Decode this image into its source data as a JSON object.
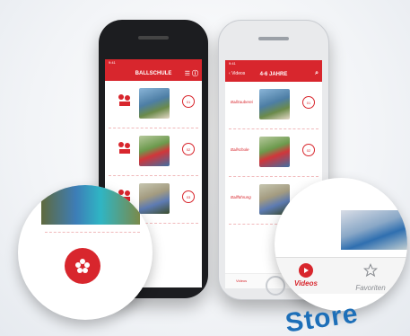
{
  "dark_phone": {
    "status": "9:41",
    "title": "BALLSCHULE",
    "rows": [
      {
        "badge": "01"
      },
      {
        "badge": "02"
      },
      {
        "badge": "03"
      }
    ]
  },
  "light_phone": {
    "status": "9:41",
    "back_label": "Videos",
    "title": "4-6 JAHRE",
    "rows": [
      {
        "label": "Ballzauberei",
        "badge": "01"
      },
      {
        "label": "Ballschule",
        "badge": "02"
      },
      {
        "label": "Ballführung",
        "badge": "03"
      }
    ],
    "tab_videos": "Videos"
  },
  "zoom_right": {
    "tab_videos": "Videos",
    "tab_favoriten": "Favoriten"
  },
  "brand_text": "Store",
  "colors": {
    "accent": "#d8262d",
    "store_blue": "#1d6fb8"
  }
}
